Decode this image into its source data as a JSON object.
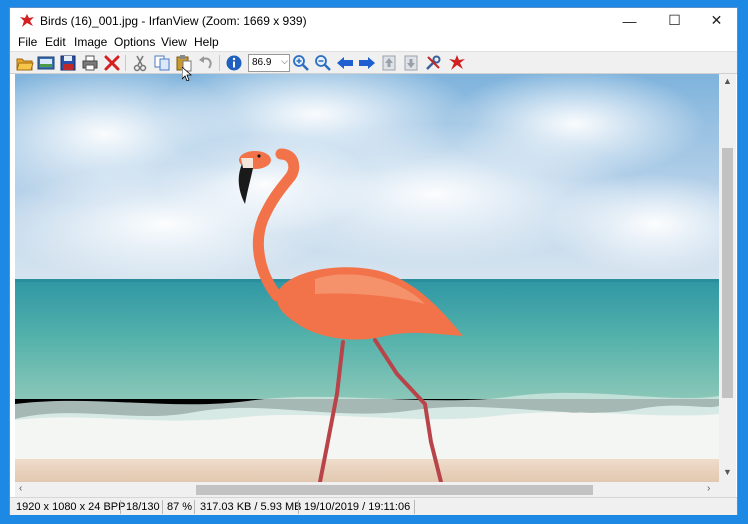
{
  "window": {
    "title": "Birds (16)_001.jpg - IrfanView (Zoom: 1669 x 939)",
    "controls": {
      "minimize": "—",
      "maximize": "☐",
      "close": "✕"
    }
  },
  "menu": {
    "items": [
      "File",
      "Edit",
      "Image",
      "Options",
      "View",
      "Help"
    ]
  },
  "toolbar": {
    "buttons": [
      {
        "name": "open-icon",
        "color": "#e8a52a"
      },
      {
        "name": "slideshow-icon",
        "color": "#3a6fb0"
      },
      {
        "name": "save-icon",
        "color": "#2a4fa8"
      },
      {
        "name": "print-icon",
        "color": "#555555"
      },
      {
        "name": "delete-icon",
        "color": "#d42020"
      },
      {
        "name": "cut-icon",
        "color": "#777777"
      },
      {
        "name": "copy-icon",
        "color": "#4a7ac0"
      },
      {
        "name": "paste-icon",
        "color": "#c89a30"
      },
      {
        "name": "undo-icon",
        "color": "#999999"
      },
      {
        "name": "info-icon",
        "color": "#1f5fbf"
      },
      {
        "name": "zoom-in-icon",
        "color": "#2a6fc0"
      },
      {
        "name": "zoom-out-icon",
        "color": "#2a6fc0"
      },
      {
        "name": "previous-icon",
        "color": "#1f5fd0"
      },
      {
        "name": "next-icon",
        "color": "#1f5fd0"
      },
      {
        "name": "first-icon",
        "color": "#9aa0a8"
      },
      {
        "name": "last-icon",
        "color": "#9aa0a8"
      },
      {
        "name": "settings-icon",
        "color": "#3a5f9a"
      },
      {
        "name": "irfanview-logo-icon",
        "color": "#d02020"
      }
    ],
    "zoom_value": "86.9"
  },
  "scrollbars": {
    "up": "▲",
    "down": "▼",
    "left": "‹",
    "right": "›"
  },
  "status": {
    "dimensions": "1920 x 1080 x 24 BPP",
    "index": "18/130",
    "zoom": "87 %",
    "size": "317.03 KB / 5.93 MB",
    "datetime": "19/10/2019 / 19:11:06"
  },
  "colors": {
    "frame": "#1e88e5",
    "sky": "#9cc4e4",
    "sea": "#4aa9a6",
    "sand": "#e8d2bd",
    "flamingo": "#f2734a"
  }
}
